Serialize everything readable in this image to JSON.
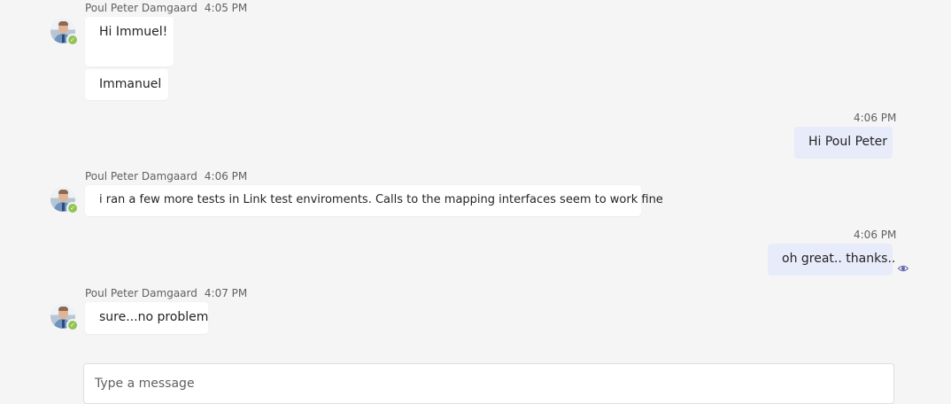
{
  "messages": [
    {
      "sender": "Poul Peter Damgaard",
      "time": "4:05 PM",
      "bubbles": [
        "Hi Immuel!",
        "Immanuel"
      ]
    },
    {
      "sender": "",
      "time": "4:06 PM",
      "bubbles": [
        "Hi Poul Peter"
      ]
    },
    {
      "sender": "Poul Peter Damgaard",
      "time": "4:06 PM",
      "bubbles": [
        "i ran a few more tests in Link test enviroments. Calls to the mapping interfaces seem to work fine"
      ]
    },
    {
      "sender": "",
      "time": "4:06 PM",
      "bubbles": [
        "oh great.. thanks.."
      ]
    },
    {
      "sender": "Poul Peter Damgaard",
      "time": "4:07 PM",
      "bubbles": [
        "sure...no problem"
      ]
    }
  ],
  "composer": {
    "placeholder": "Type a message"
  },
  "colors": {
    "background": "#f5f5f5",
    "incoming_bubble": "#ffffff",
    "outgoing_bubble": "#e8ebfa",
    "presence_available": "#92c353",
    "read_receipt": "#6264a7"
  },
  "icons": {
    "presence": "available-check-icon",
    "read_receipt": "seen-eye-icon"
  }
}
